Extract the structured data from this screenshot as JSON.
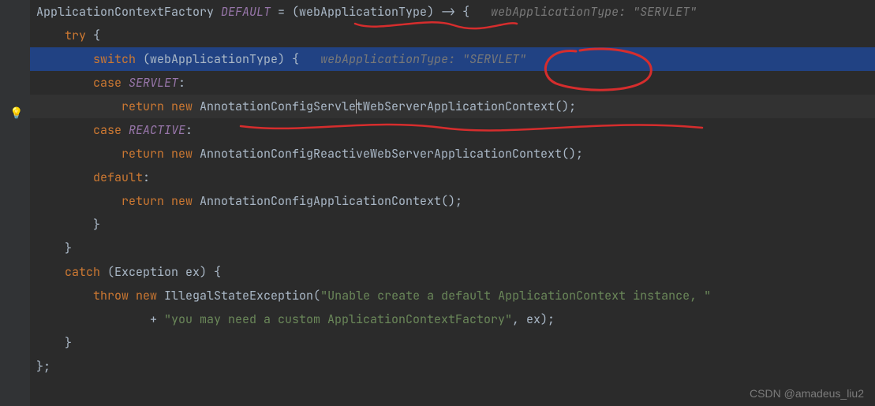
{
  "watermark": "CSDN @amadeus_liu2",
  "hints": {
    "line0": "webApplicationType: \"SERVLET\"",
    "line2": "webApplicationType: \"SERVLET\""
  },
  "code": {
    "l0_a": "ApplicationContextFactory ",
    "l0_b": "DEFAULT",
    "l0_c": " = (",
    "l0_d": "webApplicationType",
    "l0_e": ") -> {",
    "l1_a": "try",
    "l1_b": " {",
    "l2_a": "switch",
    "l2_b": " (webApplicationType) {",
    "l3_a": "case ",
    "l3_b": "SERVLET",
    "l3_c": ":",
    "l4_a": "return new ",
    "l4_b1": "AnnotationConfigServle",
    "l4_b2": "tWebServerApplicationContext",
    "l4_c": "();",
    "l5_a": "case ",
    "l5_b": "REACTIVE",
    "l5_c": ":",
    "l6_a": "return new ",
    "l6_b": "AnnotationConfigReactiveWebServerApplicationContext",
    "l6_c": "();",
    "l7_a": "default",
    "l7_b": ":",
    "l8_a": "return new ",
    "l8_b": "AnnotationConfigApplicationContext",
    "l8_c": "();",
    "l9": "}",
    "l10": "}",
    "l11_a": "catch",
    "l11_b": " (Exception ex) {",
    "l12_a": "throw new ",
    "l12_b": "IllegalStateException",
    "l12_c": "(",
    "l12_d": "\"Unable create a default ApplicationContext instance, \"",
    "l13_a": "+ ",
    "l13_b": "\"you may need a custom ApplicationContextFactory\"",
    "l13_c": ", ex);",
    "l14": "}",
    "l15": "};"
  }
}
